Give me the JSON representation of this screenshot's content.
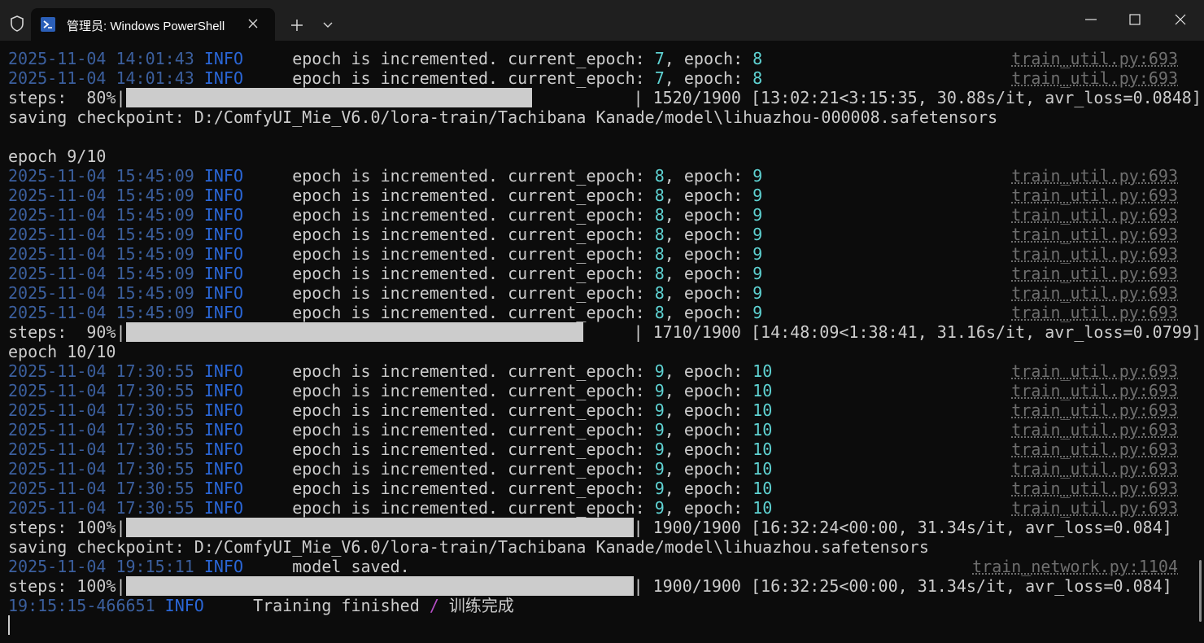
{
  "window": {
    "tab_title": "管理员: Windows PowerShell",
    "icons": {
      "shield": "shield-icon",
      "powershell": "powershell-icon",
      "close_tab": "close-icon",
      "new_tab": "plus-icon",
      "dropdown": "chevron-down-icon",
      "minimize": "minimize-icon",
      "maximize": "maximize-icon",
      "close_window": "close-icon"
    }
  },
  "terminal": {
    "lines": [
      {
        "ts": "2025-11-04 14:01:43",
        "level": "INFO",
        "msg1": "epoch is incremented. current_epoch: ",
        "n1": "7",
        "msg2": ", epoch: ",
        "n2": "8",
        "file": "train_util.py:693"
      },
      {
        "ts": "2025-11-04 14:01:43",
        "level": "INFO",
        "msg1": "epoch is incremented. current_epoch: ",
        "n1": "7",
        "msg2": ", epoch: ",
        "n2": "8",
        "file": "train_util.py:693"
      },
      {
        "progress_prefix": "steps:  80%|",
        "progress_value": 0.8,
        "progress_suffix": "| 1520/1900 [13:02:21<3:15:35, 30.88s/it, avr_loss=0.0848]"
      },
      {
        "plain": "saving checkpoint: D:/ComfyUI_Mie_V6.0/lora-train/Tachibana Kanade/model\\lihuazhou-000008.safetensors"
      },
      {
        "plain": ""
      },
      {
        "plain": "epoch 9/10"
      },
      {
        "ts": "2025-11-04 15:45:09",
        "level": "INFO",
        "msg1": "epoch is incremented. current_epoch: ",
        "n1": "8",
        "msg2": ", epoch: ",
        "n2": "9",
        "file": "train_util.py:693"
      },
      {
        "ts": "2025-11-04 15:45:09",
        "level": "INFO",
        "msg1": "epoch is incremented. current_epoch: ",
        "n1": "8",
        "msg2": ", epoch: ",
        "n2": "9",
        "file": "train_util.py:693"
      },
      {
        "ts": "2025-11-04 15:45:09",
        "level": "INFO",
        "msg1": "epoch is incremented. current_epoch: ",
        "n1": "8",
        "msg2": ", epoch: ",
        "n2": "9",
        "file": "train_util.py:693"
      },
      {
        "ts": "2025-11-04 15:45:09",
        "level": "INFO",
        "msg1": "epoch is incremented. current_epoch: ",
        "n1": "8",
        "msg2": ", epoch: ",
        "n2": "9",
        "file": "train_util.py:693"
      },
      {
        "ts": "2025-11-04 15:45:09",
        "level": "INFO",
        "msg1": "epoch is incremented. current_epoch: ",
        "n1": "8",
        "msg2": ", epoch: ",
        "n2": "9",
        "file": "train_util.py:693"
      },
      {
        "ts": "2025-11-04 15:45:09",
        "level": "INFO",
        "msg1": "epoch is incremented. current_epoch: ",
        "n1": "8",
        "msg2": ", epoch: ",
        "n2": "9",
        "file": "train_util.py:693"
      },
      {
        "ts": "2025-11-04 15:45:09",
        "level": "INFO",
        "msg1": "epoch is incremented. current_epoch: ",
        "n1": "8",
        "msg2": ", epoch: ",
        "n2": "9",
        "file": "train_util.py:693"
      },
      {
        "ts": "2025-11-04 15:45:09",
        "level": "INFO",
        "msg1": "epoch is incremented. current_epoch: ",
        "n1": "8",
        "msg2": ", epoch: ",
        "n2": "9",
        "file": "train_util.py:693"
      },
      {
        "progress_prefix": "steps:  90%|",
        "progress_value": 0.9,
        "progress_suffix": "| 1710/1900 [14:48:09<1:38:41, 31.16s/it, avr_loss=0.0799]"
      },
      {
        "plain": "epoch 10/10"
      },
      {
        "ts": "2025-11-04 17:30:55",
        "level": "INFO",
        "msg1": "epoch is incremented. current_epoch: ",
        "n1": "9",
        "msg2": ", epoch: ",
        "n2": "10",
        "file": "train_util.py:693"
      },
      {
        "ts": "2025-11-04 17:30:55",
        "level": "INFO",
        "msg1": "epoch is incremented. current_epoch: ",
        "n1": "9",
        "msg2": ", epoch: ",
        "n2": "10",
        "file": "train_util.py:693"
      },
      {
        "ts": "2025-11-04 17:30:55",
        "level": "INFO",
        "msg1": "epoch is incremented. current_epoch: ",
        "n1": "9",
        "msg2": ", epoch: ",
        "n2": "10",
        "file": "train_util.py:693"
      },
      {
        "ts": "2025-11-04 17:30:55",
        "level": "INFO",
        "msg1": "epoch is incremented. current_epoch: ",
        "n1": "9",
        "msg2": ", epoch: ",
        "n2": "10",
        "file": "train_util.py:693"
      },
      {
        "ts": "2025-11-04 17:30:55",
        "level": "INFO",
        "msg1": "epoch is incremented. current_epoch: ",
        "n1": "9",
        "msg2": ", epoch: ",
        "n2": "10",
        "file": "train_util.py:693"
      },
      {
        "ts": "2025-11-04 17:30:55",
        "level": "INFO",
        "msg1": "epoch is incremented. current_epoch: ",
        "n1": "9",
        "msg2": ", epoch: ",
        "n2": "10",
        "file": "train_util.py:693"
      },
      {
        "ts": "2025-11-04 17:30:55",
        "level": "INFO",
        "msg1": "epoch is incremented. current_epoch: ",
        "n1": "9",
        "msg2": ", epoch: ",
        "n2": "10",
        "file": "train_util.py:693"
      },
      {
        "ts": "2025-11-04 17:30:55",
        "level": "INFO",
        "msg1": "epoch is incremented. current_epoch: ",
        "n1": "9",
        "msg2": ", epoch: ",
        "n2": "10",
        "file": "train_util.py:693"
      },
      {
        "progress_prefix": "steps: 100%|",
        "progress_value": 1.0,
        "progress_suffix": "| 1900/1900 [16:32:24<00:00, 31.34s/it, avr_loss=0.084]"
      },
      {
        "plain": "saving checkpoint: D:/ComfyUI_Mie_V6.0/lora-train/Tachibana Kanade/model\\lihuazhou.safetensors"
      },
      {
        "ts": "2025-11-04 19:15:11",
        "level": "INFO",
        "msg1": "model saved.",
        "file": "train_network.py:1104"
      },
      {
        "progress_prefix": "steps: 100%|",
        "progress_value": 1.0,
        "progress_suffix": "| 1900/1900 [16:32:25<00:00, 31.34s/it, avr_loss=0.084]"
      },
      {
        "ts": "19:15:15-466651",
        "level": "INFO",
        "msg1": "Training finished ",
        "slash": "/",
        "msg2": " 训练完成",
        "short": true
      }
    ]
  },
  "colors": {
    "background": "#0c0c0c",
    "titlebar": "#1f1f1f",
    "timestamp": "#3b5f9e",
    "info": "#2a66d6",
    "number": "#5fd3d3",
    "file": "#6f6f6f",
    "text": "#cccccc",
    "slash": "#b54ec6"
  }
}
